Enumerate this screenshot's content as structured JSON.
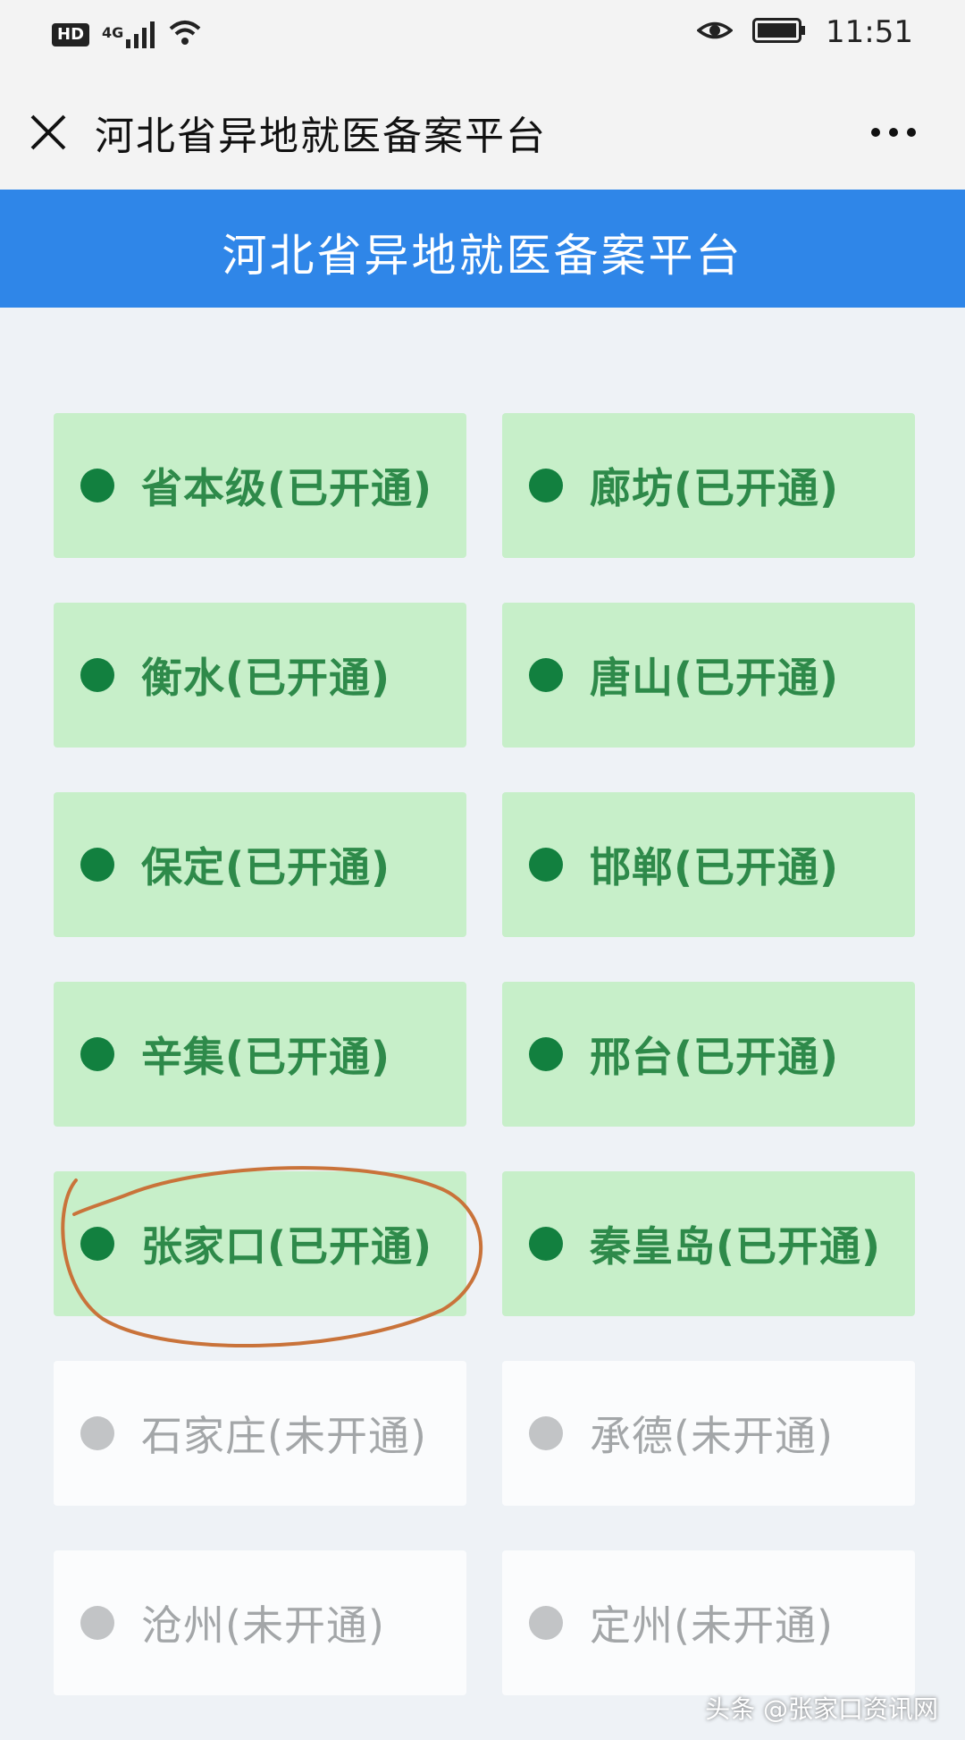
{
  "status_bar": {
    "hd": "HD",
    "network": "4G",
    "time": "11:51"
  },
  "title_bar": {
    "title": "河北省异地就医备案平台",
    "close_icon": "close-icon",
    "more_icon": "more-icon"
  },
  "header": {
    "title": "河北省异地就医备案平台",
    "color": "#2f86e8"
  },
  "regions": [
    {
      "label": "省本级(已开通)",
      "status": "open"
    },
    {
      "label": "廊坊(已开通)",
      "status": "open"
    },
    {
      "label": "衡水(已开通)",
      "status": "open"
    },
    {
      "label": "唐山(已开通)",
      "status": "open"
    },
    {
      "label": "保定(已开通)",
      "status": "open"
    },
    {
      "label": "邯郸(已开通)",
      "status": "open"
    },
    {
      "label": "辛集(已开通)",
      "status": "open"
    },
    {
      "label": "邢台(已开通)",
      "status": "open"
    },
    {
      "label": "张家口(已开通)",
      "status": "open"
    },
    {
      "label": "秦皇岛(已开通)",
      "status": "open"
    },
    {
      "label": "石家庄(未开通)",
      "status": "closed"
    },
    {
      "label": "承德(未开通)",
      "status": "closed"
    },
    {
      "label": "沧州(未开通)",
      "status": "closed"
    },
    {
      "label": "定州(未开通)",
      "status": "closed"
    }
  ],
  "colors": {
    "open_tile": "#c7efc9",
    "open_dot": "#12803f",
    "closed_tile": "#fbfcfd",
    "closed_dot": "#c2c4c6",
    "annotation": "#c9733a"
  },
  "watermark": "头条 @张家口资讯网"
}
